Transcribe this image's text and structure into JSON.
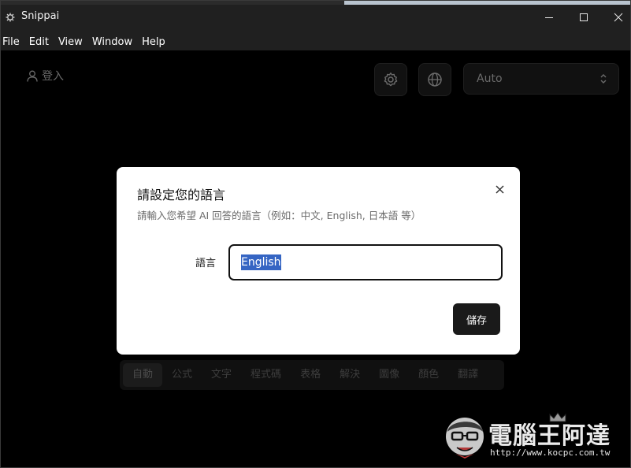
{
  "window": {
    "title": "Snippai"
  },
  "menu": [
    "File",
    "Edit",
    "View",
    "Window",
    "Help"
  ],
  "header": {
    "login_label": "登入",
    "model_select_value": "Auto"
  },
  "mode_tabs": [
    {
      "label": "自動",
      "active": true
    },
    {
      "label": "公式"
    },
    {
      "label": "文字"
    },
    {
      "label": "程式碼"
    },
    {
      "label": "表格"
    },
    {
      "label": "解決"
    },
    {
      "label": "圖像"
    },
    {
      "label": "顏色"
    },
    {
      "label": "翻譯"
    }
  ],
  "dialog": {
    "title": "請設定您的語言",
    "description": "請輸入您希望 AI 回答的語言（例如：中文, English, 日本語 等）",
    "field_label": "語言",
    "field_value": "English",
    "save_label": "儲存"
  },
  "watermark": {
    "title": "電腦王阿達",
    "url": "http://www.kocpc.com.tw"
  },
  "colors": {
    "titlebar": "#202020",
    "background": "#000000",
    "dialog_bg": "#ffffff",
    "selection": "#3565c3",
    "primary_button": "#1a1a1a"
  }
}
